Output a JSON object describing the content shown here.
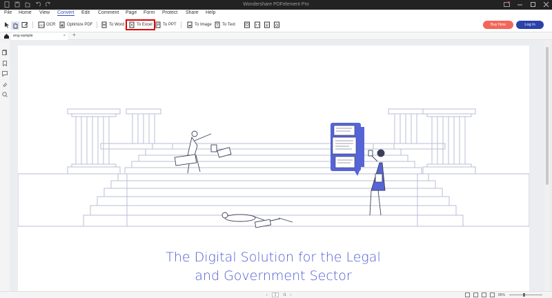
{
  "app": {
    "title": "Wondershare PDFelement Pro"
  },
  "menu": {
    "items": [
      "File",
      "Home",
      "View",
      "Convert",
      "Edit",
      "Comment",
      "Page",
      "Form",
      "Protect",
      "Share",
      "Help"
    ],
    "active": "Convert"
  },
  "ribbon": {
    "ocr": "OCR",
    "optimize": "Optimize PDF",
    "to_word": "To Word",
    "to_excel": "To Excel",
    "to_ppt": "To PPT",
    "to_image": "To Image",
    "to_text": "To Text"
  },
  "buttons": {
    "buy_now": "Buy Now",
    "log_in": "Log In"
  },
  "tab": {
    "name": "eng-sample",
    "close": "×",
    "add": "+"
  },
  "document": {
    "headline_line1": "The Digital Solution for the Legal",
    "headline_line2": "and Government Sector"
  },
  "status": {
    "page_current": "1",
    "page_total": "/1",
    "zoom": "86%"
  },
  "colors": {
    "accent": "#3a4bb0",
    "buy": "#f2665a",
    "login": "#2b43a8",
    "illustration_blue": "#4f5bd5",
    "highlight": "#e00000"
  }
}
